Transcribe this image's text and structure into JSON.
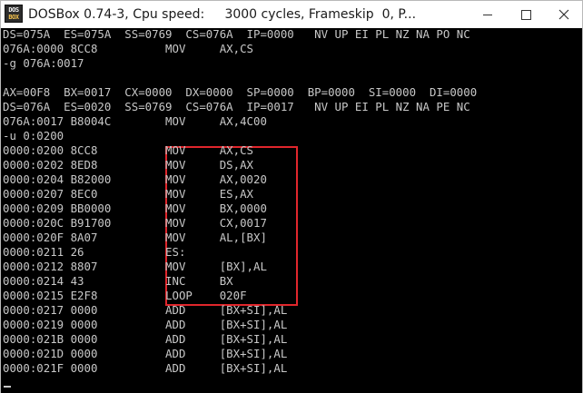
{
  "window": {
    "title": "DOSBox 0.74-3, Cpu speed:     3000 cycles, Frameskip  0, P...",
    "icon_top": "DOS",
    "icon_bottom": "BOX"
  },
  "console": {
    "lines": [
      "DS=075A  ES=075A  SS=0769  CS=076A  IP=0000   NV UP EI PL NZ NA PO NC",
      "076A:0000 8CC8          MOV     AX,CS",
      "-g 076A:0017",
      "",
      "AX=00F8  BX=0017  CX=0000  DX=0000  SP=0000  BP=0000  SI=0000  DI=0000",
      "DS=076A  ES=0020  SS=0769  CS=076A  IP=0017   NV UP EI PL NZ NA PE NC",
      "076A:0017 B8004C        MOV     AX,4C00",
      "-u 0:0200",
      "0000:0200 8CC8          MOV     AX,CS",
      "0000:0202 8ED8          MOV     DS,AX",
      "0000:0204 B82000        MOV     AX,0020",
      "0000:0207 8EC0          MOV     ES,AX",
      "0000:0209 BB0000        MOV     BX,0000",
      "0000:020C B91700        MOV     CX,0017",
      "0000:020F 8A07          MOV     AL,[BX]",
      "0000:0211 26            ES:",
      "0000:0212 8807          MOV     [BX],AL",
      "0000:0214 43            INC     BX",
      "0000:0215 E2F8          LOOP    020F",
      "0000:0217 0000          ADD     [BX+SI],AL",
      "0000:0219 0000          ADD     [BX+SI],AL",
      "0000:021B 0000          ADD     [BX+SI],AL",
      "0000:021D 0000          ADD     [BX+SI],AL",
      "0000:021F 0000          ADD     [BX+SI],AL",
      "-"
    ]
  },
  "colors": {
    "text": "#c8c8c8",
    "background": "#000000",
    "highlight": "#e0262c"
  },
  "icons": [
    "dosbox-app-icon",
    "minimize-icon",
    "maximize-icon",
    "close-icon"
  ]
}
